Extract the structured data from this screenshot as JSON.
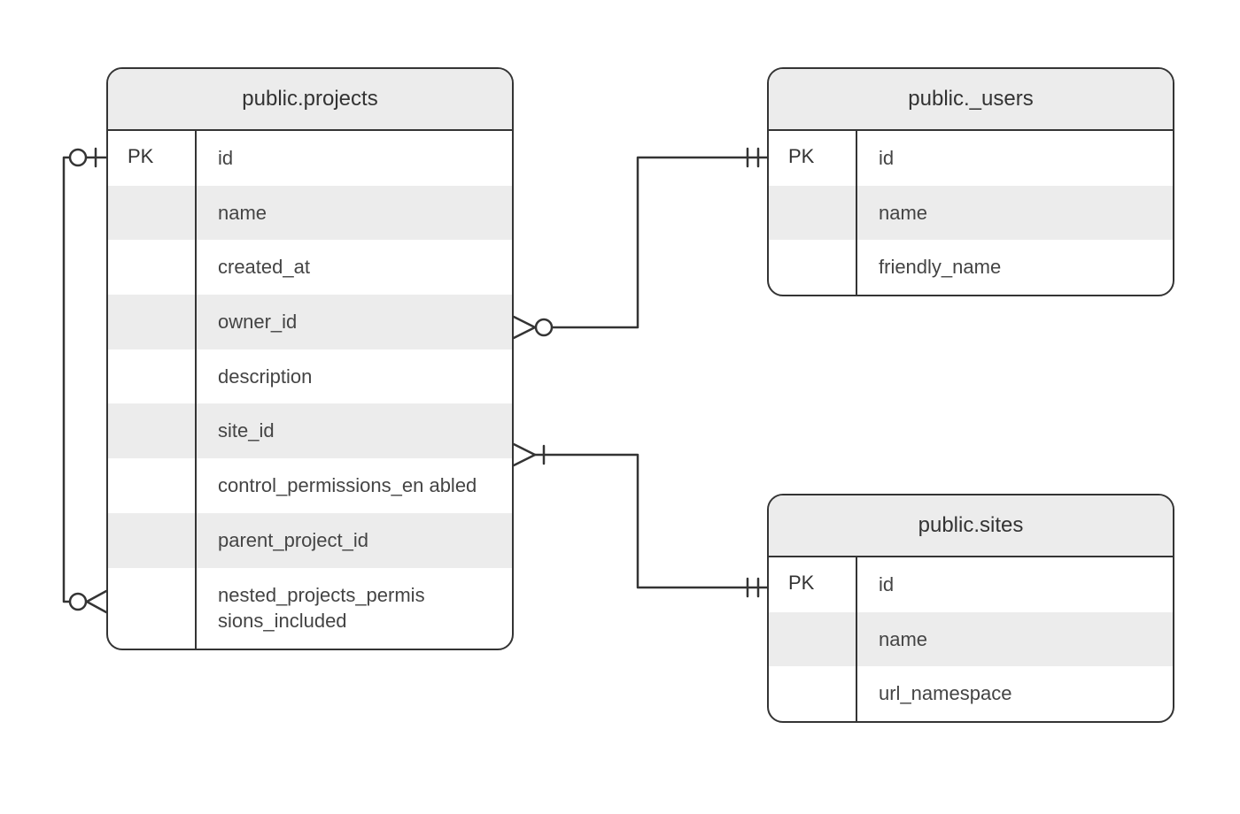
{
  "entities": {
    "projects": {
      "title": "public.projects",
      "columns": [
        {
          "key": "PK",
          "name": "id"
        },
        {
          "key": "",
          "name": "name"
        },
        {
          "key": "",
          "name": "created_at"
        },
        {
          "key": "",
          "name": "owner_id"
        },
        {
          "key": "",
          "name": "description"
        },
        {
          "key": "",
          "name": "site_id"
        },
        {
          "key": "",
          "name": "control_permissions_en\nabled"
        },
        {
          "key": "",
          "name": "parent_project_id"
        },
        {
          "key": "",
          "name": "nested_projects_permis\nsions_included"
        }
      ]
    },
    "users": {
      "title": "public._users",
      "columns": [
        {
          "key": "PK",
          "name": "id"
        },
        {
          "key": "",
          "name": "name"
        },
        {
          "key": "",
          "name": "friendly_name"
        }
      ]
    },
    "sites": {
      "title": "public.sites",
      "columns": [
        {
          "key": "PK",
          "name": "id"
        },
        {
          "key": "",
          "name": "name"
        },
        {
          "key": "",
          "name": "url_namespace"
        }
      ]
    }
  },
  "relationships": [
    {
      "from": {
        "entity": "projects",
        "column": "owner_id",
        "cardinality": "zero-or-many"
      },
      "to": {
        "entity": "users",
        "column": "id",
        "cardinality": "one"
      }
    },
    {
      "from": {
        "entity": "projects",
        "column": "site_id",
        "cardinality": "one-or-many"
      },
      "to": {
        "entity": "sites",
        "column": "id",
        "cardinality": "one"
      }
    },
    {
      "from": {
        "entity": "projects",
        "column": "parent_project_id",
        "cardinality": "zero-or-many"
      },
      "to": {
        "entity": "projects",
        "column": "id",
        "cardinality": "zero-or-one"
      },
      "self": true
    }
  ]
}
